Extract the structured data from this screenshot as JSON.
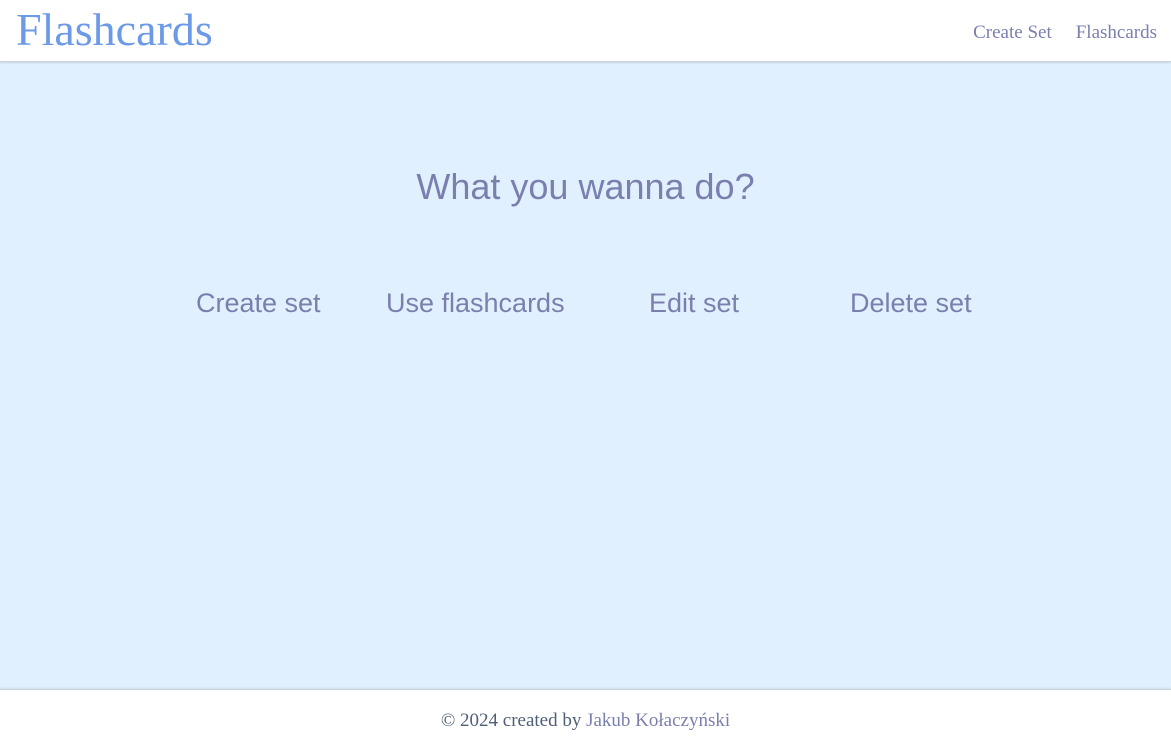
{
  "header": {
    "brand": "Flashcards",
    "nav": {
      "create_set": "Create Set",
      "flashcards": "Flashcards"
    }
  },
  "main": {
    "heading": "What you wanna do?",
    "actions": {
      "create": "Create set",
      "use": "Use flashcards",
      "edit": "Edit set",
      "delete": "Delete set"
    }
  },
  "footer": {
    "prefix": "© 2024 created by",
    "author": "Jakub Kołaczyński"
  },
  "colors": {
    "brand": "#6c9ae6",
    "link": "#7a7fae",
    "background": "#e1f0fe",
    "footer_text": "#4f5f78"
  }
}
